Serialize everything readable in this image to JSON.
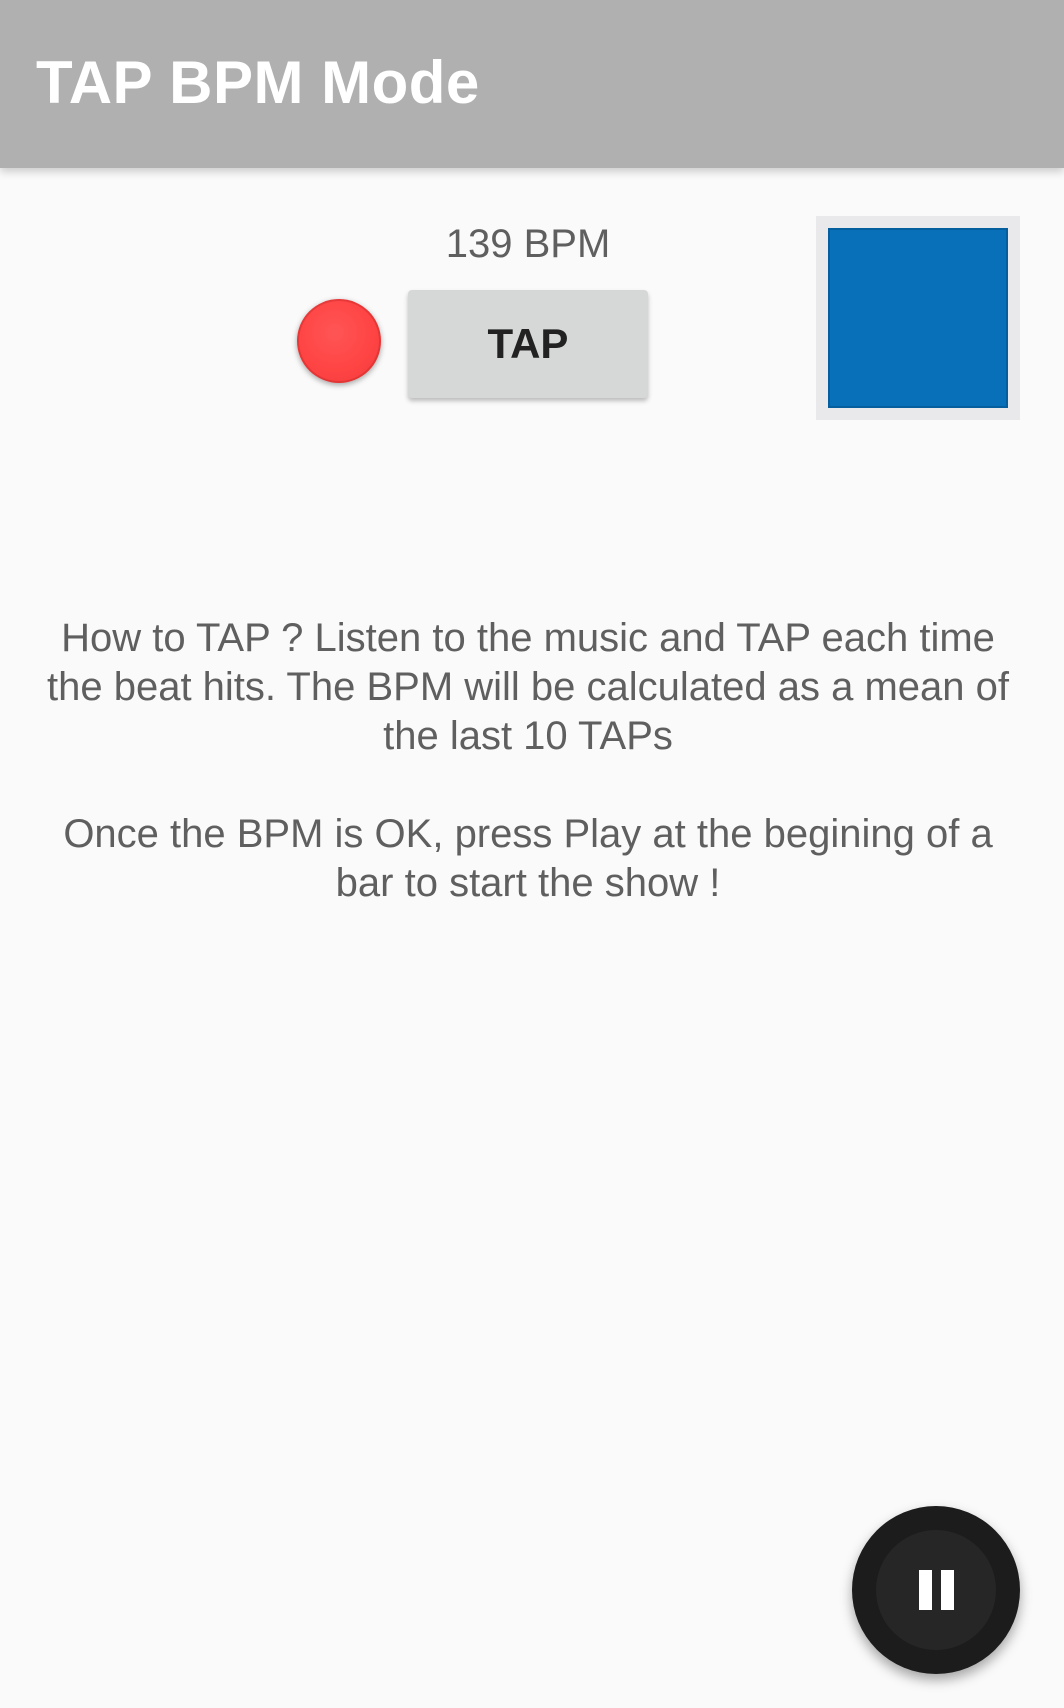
{
  "app_bar": {
    "title": "TAP BPM Mode",
    "background_color": "#b0b0b0"
  },
  "tempo": {
    "bpm_display": "139 BPM",
    "tap_button_label": "TAP",
    "indicator_color": "#ff4444",
    "beat_square_color": "#0870b8"
  },
  "instructions": {
    "paragraph_1": "How to TAP ? Listen to the music and TAP each time the beat hits. The BPM will be calculated as a mean of the last 10 TAPs",
    "paragraph_2": "Once the BPM is OK, press Play at the begining of a bar to start the show !"
  },
  "fab": {
    "icon": "pause-icon"
  }
}
